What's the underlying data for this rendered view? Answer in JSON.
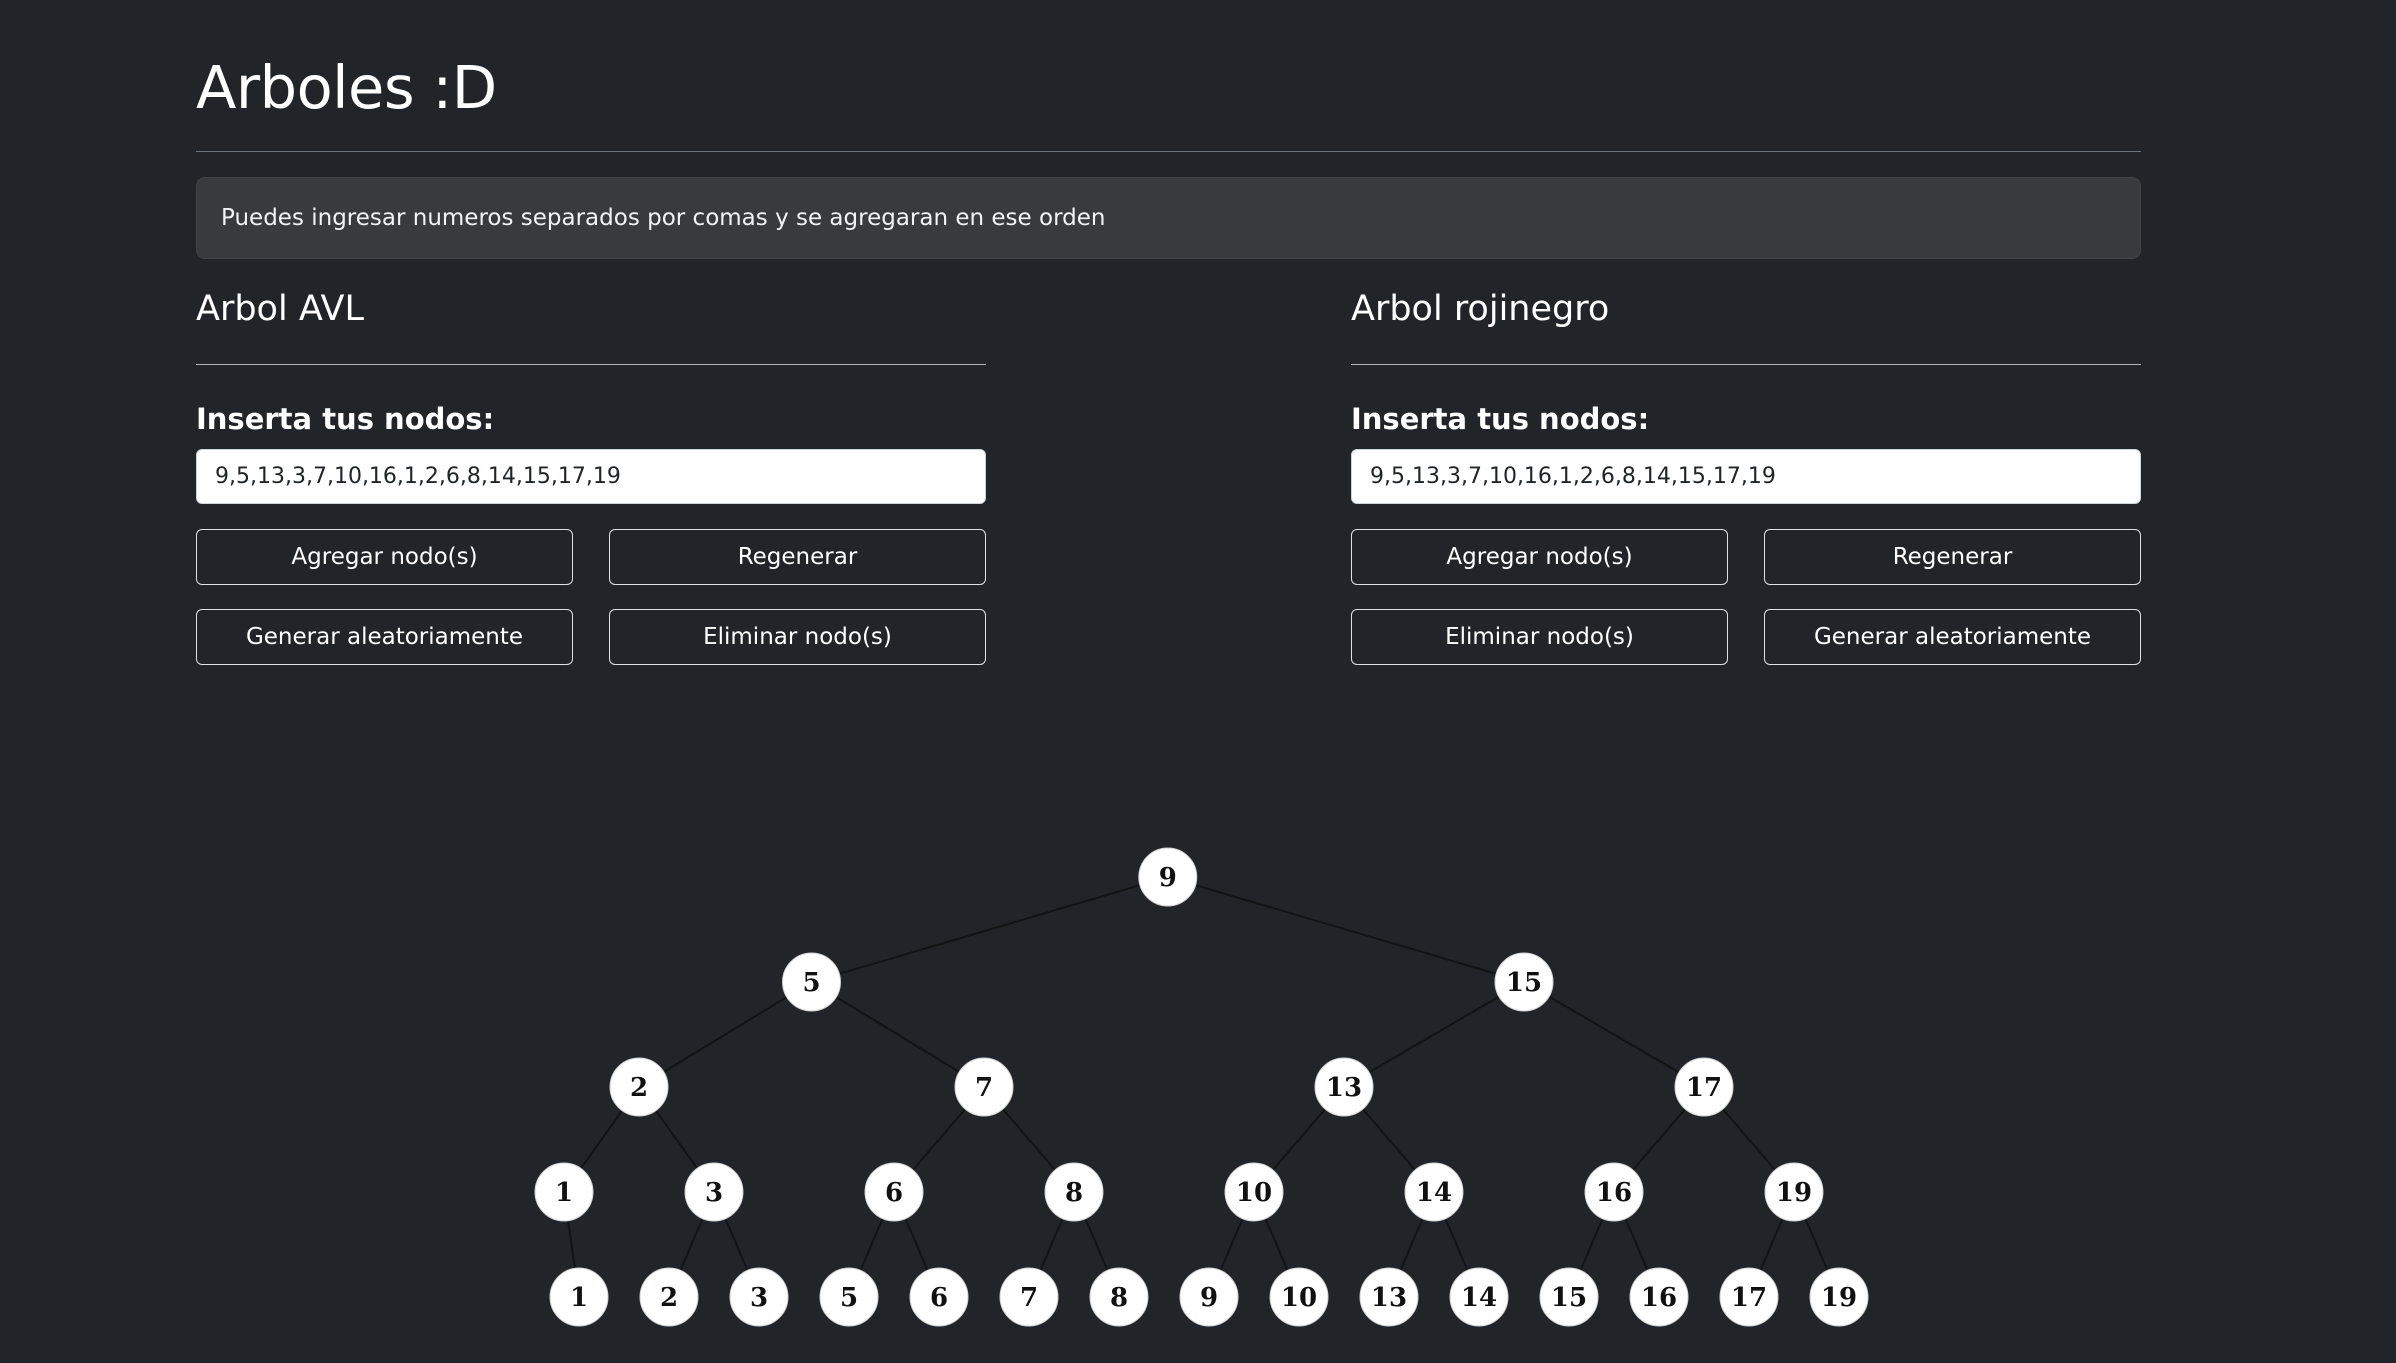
{
  "header": {
    "title": "Arboles :D"
  },
  "alert": {
    "text": "Puedes ingresar numeros separados por comas y se agregaran en ese orden"
  },
  "avl": {
    "title": "Arbol AVL",
    "input_label": "Inserta tus nodos:",
    "input_value": "9,5,13,3,7,10,16,1,2,6,8,14,15,17,19",
    "buttons": {
      "add": "Agregar nodo(s)",
      "regenerate": "Regenerar",
      "random": "Generar aleatoriamente",
      "delete": "Eliminar nodo(s)"
    }
  },
  "rb": {
    "title": "Arbol rojinegro",
    "input_label": "Inserta tus nodos:",
    "input_value": "9,5,13,3,7,10,16,1,2,6,8,14,15,17,19",
    "buttons": {
      "add": "Agregar nodo(s)",
      "regenerate": "Regenerar",
      "delete": "Eliminar nodo(s)",
      "random": "Generar aleatoriamente"
    }
  },
  "tree": {
    "root": {
      "label": "9",
      "children": [
        {
          "label": "5",
          "children": [
            {
              "label": "2",
              "children": [
                {
                  "label": "1",
                  "children": [
                    {
                      "label": "1",
                      "children": []
                    }
                  ]
                },
                {
                  "label": "3",
                  "children": [
                    {
                      "label": "2",
                      "children": []
                    },
                    {
                      "label": "3",
                      "children": []
                    }
                  ]
                }
              ]
            },
            {
              "label": "7",
              "children": [
                {
                  "label": "6",
                  "children": [
                    {
                      "label": "5",
                      "children": []
                    },
                    {
                      "label": "6",
                      "children": []
                    }
                  ]
                },
                {
                  "label": "8",
                  "children": [
                    {
                      "label": "7",
                      "children": []
                    },
                    {
                      "label": "8",
                      "children": []
                    }
                  ]
                }
              ]
            }
          ]
        },
        {
          "label": "15",
          "children": [
            {
              "label": "13",
              "children": [
                {
                  "label": "10",
                  "children": [
                    {
                      "label": "9",
                      "children": []
                    },
                    {
                      "label": "10",
                      "children": []
                    }
                  ]
                },
                {
                  "label": "14",
                  "children": [
                    {
                      "label": "13",
                      "children": []
                    },
                    {
                      "label": "14",
                      "children": []
                    }
                  ]
                }
              ]
            },
            {
              "label": "17",
              "children": [
                {
                  "label": "16",
                  "children": [
                    {
                      "label": "15",
                      "children": []
                    },
                    {
                      "label": "16",
                      "children": []
                    }
                  ]
                },
                {
                  "label": "19",
                  "children": [
                    {
                      "label": "17",
                      "children": []
                    },
                    {
                      "label": "19",
                      "children": []
                    }
                  ]
                }
              ]
            }
          ]
        }
      ]
    }
  }
}
